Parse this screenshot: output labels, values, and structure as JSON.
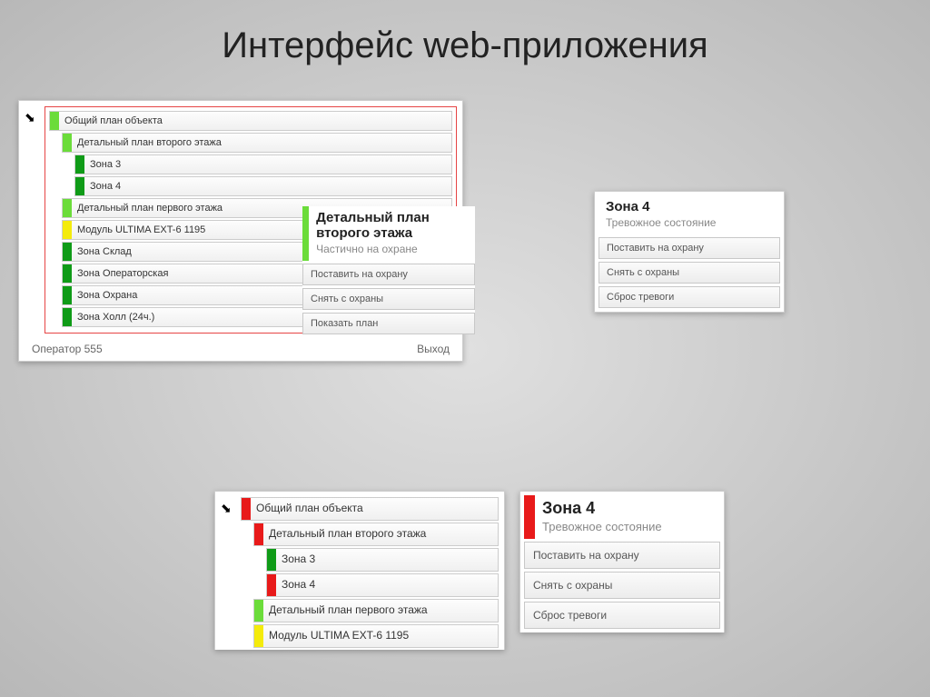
{
  "slide": {
    "title": "Интерфейс web-приложения"
  },
  "tree": {
    "items": [
      {
        "label": "Общий план объекта",
        "indent": 0,
        "color": "c-green-l"
      },
      {
        "label": "Детальный план второго этажа",
        "indent": 1,
        "color": "c-green-l"
      },
      {
        "label": "Зона 3",
        "indent": 2,
        "color": "c-green-d"
      },
      {
        "label": "Зона 4",
        "indent": 2,
        "color": "c-green-d"
      },
      {
        "label": "Детальный план первого этажа",
        "indent": 1,
        "color": "c-green-l"
      },
      {
        "label": "Модуль ULTIMA EXT-6 1195",
        "indent": 1,
        "color": "c-yellow"
      },
      {
        "label": "Зона Склад",
        "indent": 1,
        "color": "c-green-d"
      },
      {
        "label": "Зона Операторская",
        "indent": 1,
        "color": "c-green-d"
      },
      {
        "label": "Зона Охрана",
        "indent": 1,
        "color": "c-green-d"
      },
      {
        "label": "Зона Холл (24ч.)",
        "indent": 1,
        "color": "c-green-d"
      }
    ],
    "footer": {
      "operator": "Оператор 555",
      "exit": "Выход"
    }
  },
  "detail1": {
    "title": "Детальный план второго этажа",
    "subtitle": "Частично на охране",
    "barColor": "c-green-l",
    "actions": [
      "Поставить на охрану",
      "Снять с охраны",
      "Показать план"
    ]
  },
  "zone4_top": {
    "title": "Зона 4",
    "subtitle": "Тревожное состояние",
    "barColor": "c-red",
    "actions": [
      "Поставить на охрану",
      "Снять с охраны",
      "Сброс тревоги"
    ]
  },
  "tree_b": {
    "items": [
      {
        "label": "Общий план объекта",
        "indent": 0,
        "color": "c-red"
      },
      {
        "label": "Детальный план второго этажа",
        "indent": 1,
        "color": "c-red"
      },
      {
        "label": "Зона 3",
        "indent": 2,
        "color": "c-green-d"
      },
      {
        "label": "Зона 4",
        "indent": 2,
        "color": "c-red"
      },
      {
        "label": "Детальный план первого этажа",
        "indent": 1,
        "color": "c-green-l"
      },
      {
        "label": "Модуль ULTIMA EXT-6 1195",
        "indent": 1,
        "color": "c-yellow"
      }
    ]
  },
  "zone4_bottom": {
    "title": "Зона 4",
    "subtitle": "Тревожное состояние",
    "barColor": "c-red",
    "actions": [
      "Поставить на охрану",
      "Снять с охраны",
      "Сброс тревоги"
    ]
  }
}
